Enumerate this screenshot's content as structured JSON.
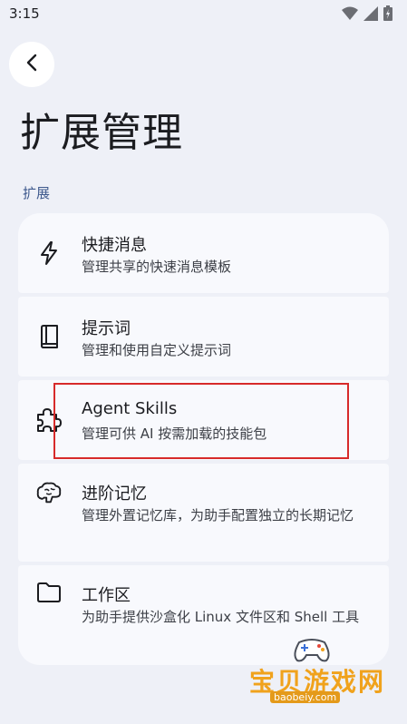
{
  "status_bar": {
    "time": "3:15",
    "icons": [
      "wifi-icon",
      "signal-icon",
      "battery-icon"
    ]
  },
  "header": {
    "back_icon": "chevron-left-icon",
    "title": "扩展管理"
  },
  "section": {
    "label": "扩展"
  },
  "items": [
    {
      "icon": "lightning-icon",
      "title": "快捷消息",
      "subtitle": "管理共享的快速消息模板"
    },
    {
      "icon": "book-icon",
      "title": "提示词",
      "subtitle": "管理和使用自定义提示词"
    },
    {
      "icon": "puzzle-icon",
      "title": "Agent Skills",
      "subtitle": "管理可供 AI 按需加载的技能包"
    },
    {
      "icon": "brain-icon",
      "title": "进阶记忆",
      "subtitle": "管理外置记忆库，为助手配置独立的长期记忆"
    },
    {
      "icon": "folder-icon",
      "title": "工作区",
      "subtitle": "为助手提供沙盒化 Linux 文件区和 Shell 工具"
    }
  ],
  "watermark": {
    "text": "宝贝游戏网",
    "url": "baobeiy.com"
  },
  "colors": {
    "background": "#eef0f7",
    "card": "#f8f9fd",
    "section_label": "#3f5a8e",
    "highlight": "#d72a2a"
  }
}
